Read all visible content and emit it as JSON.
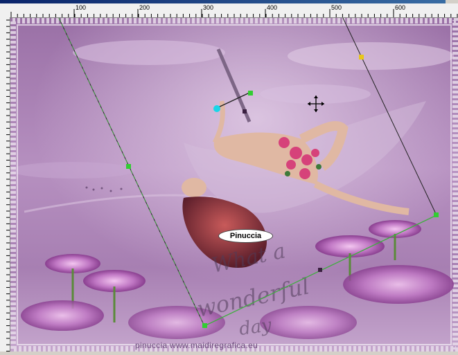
{
  "ruler": {
    "h_labels": [
      "100",
      "200",
      "300",
      "400",
      "500",
      "600"
    ]
  },
  "canvas": {
    "badge_text": "Pinuccia",
    "overlay_lines": [
      "What a",
      "wonderful",
      "day"
    ],
    "credit": "pinuccia www.maidiregrafica.eu"
  },
  "colors": {
    "bg_purple": "#a77fb2",
    "deform_line_green": "#3fae3f",
    "handle_green": "#32cd32",
    "handle_cyan": "#1ad6e8",
    "handle_yellow": "#e8c71a"
  },
  "icons": [
    "move-cursor-icon",
    "rotation-handle-icon",
    "pick-tool-handle-icon"
  ]
}
